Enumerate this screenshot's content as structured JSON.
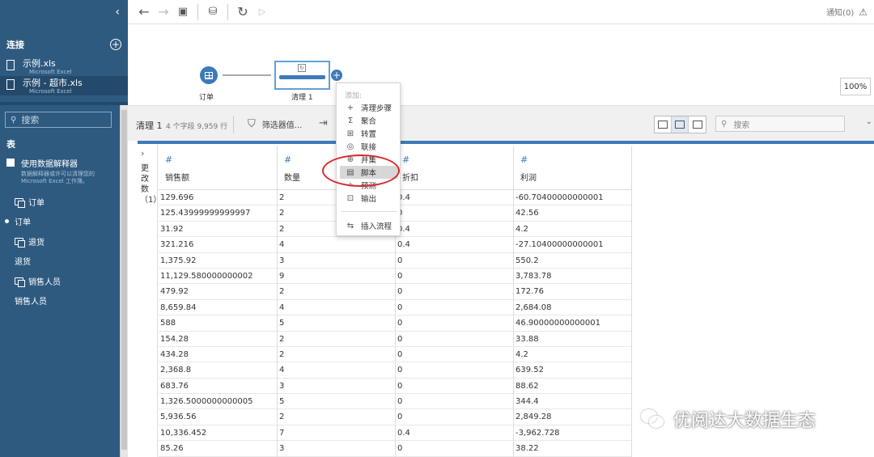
{
  "sidebar": {
    "collapse": "‹",
    "connections_title": "连接",
    "add": "+",
    "connections": [
      {
        "name": "示例.xls",
        "sub": "Microsoft Excel"
      },
      {
        "name": "示例 - 超市.xls",
        "sub": "Microsoft Excel"
      }
    ],
    "search_placeholder": "搜索",
    "tables_title": "表",
    "interpreter_label": "使用数据解释器",
    "interpreter_desc": "数据解释器或许可以清理您的 Microsoft Excel 工作簿。",
    "tables": [
      {
        "name": "订单",
        "icon": "join"
      },
      {
        "name": "订单",
        "icon": "grid"
      },
      {
        "name": "退货",
        "icon": "join"
      },
      {
        "name": "退货",
        "icon": "grid"
      },
      {
        "name": "销售人员",
        "icon": "join"
      },
      {
        "name": "销售人员",
        "icon": "grid"
      }
    ]
  },
  "toolbar": {
    "notify": "通知(0)"
  },
  "canvas": {
    "node1_label": "订单",
    "node2_label": "清理 1",
    "zoom": "100%"
  },
  "profile": {
    "name": "清理 1",
    "meta": "4 个字段  9,959 行",
    "filter": "筛选器值...",
    "search_placeholder": "搜索"
  },
  "changes_label": "更改数（1）",
  "menu": {
    "title": "添加:",
    "items": [
      {
        "icon": "+",
        "label": "清理步骤"
      },
      {
        "icon": "Σ",
        "label": "聚合"
      },
      {
        "icon": "⊞",
        "label": "转置"
      },
      {
        "icon": "◎",
        "label": "联接"
      },
      {
        "icon": "⊕",
        "label": "并集"
      },
      {
        "icon": "▤",
        "label": "脚本"
      },
      {
        "icon": "✧",
        "label": "预测"
      },
      {
        "icon": "⊡",
        "label": "输出"
      },
      {
        "icon": "⇆",
        "label": "插入流程"
      }
    ]
  },
  "table": {
    "columns": [
      {
        "type": "#",
        "name": "销售额"
      },
      {
        "type": "#",
        "name": "数量"
      },
      {
        "type": "#",
        "name": "折扣"
      },
      {
        "type": "#",
        "name": "利润"
      }
    ],
    "rows": [
      [
        "129.696",
        "2",
        "0.4",
        "-60.70400000000001"
      ],
      [
        "125.43999999999997",
        "2",
        "0",
        "42.56"
      ],
      [
        "31.92",
        "2",
        "0.4",
        "4.2"
      ],
      [
        "321.216",
        "4",
        "0.4",
        "-27.10400000000001"
      ],
      [
        "1,375.92",
        "3",
        "0",
        "550.2"
      ],
      [
        "11,129.580000000002",
        "9",
        "0",
        "3,783.78"
      ],
      [
        "479.92",
        "2",
        "0",
        "172.76"
      ],
      [
        "8,659.84",
        "4",
        "0",
        "2,684.08"
      ],
      [
        "588",
        "5",
        "0",
        "46.90000000000001"
      ],
      [
        "154.28",
        "2",
        "0",
        "33.88"
      ],
      [
        "434.28",
        "2",
        "0",
        "4.2"
      ],
      [
        "2,368.8",
        "4",
        "0",
        "639.52"
      ],
      [
        "683.76",
        "3",
        "0",
        "88.62"
      ],
      [
        "1,326.5000000000005",
        "5",
        "0",
        "344.4"
      ],
      [
        "5,936.56",
        "2",
        "0",
        "2,849.28"
      ],
      [
        "10,336.452",
        "7",
        "0.4",
        "-3,962.728"
      ],
      [
        "85.26",
        "3",
        "0",
        "38.22"
      ]
    ]
  },
  "watermark": "优阅达大数据生态",
  "colors": {
    "sidebar": "#2e5a80",
    "accent": "#3d7ab8",
    "annotation": "#d9262b"
  }
}
